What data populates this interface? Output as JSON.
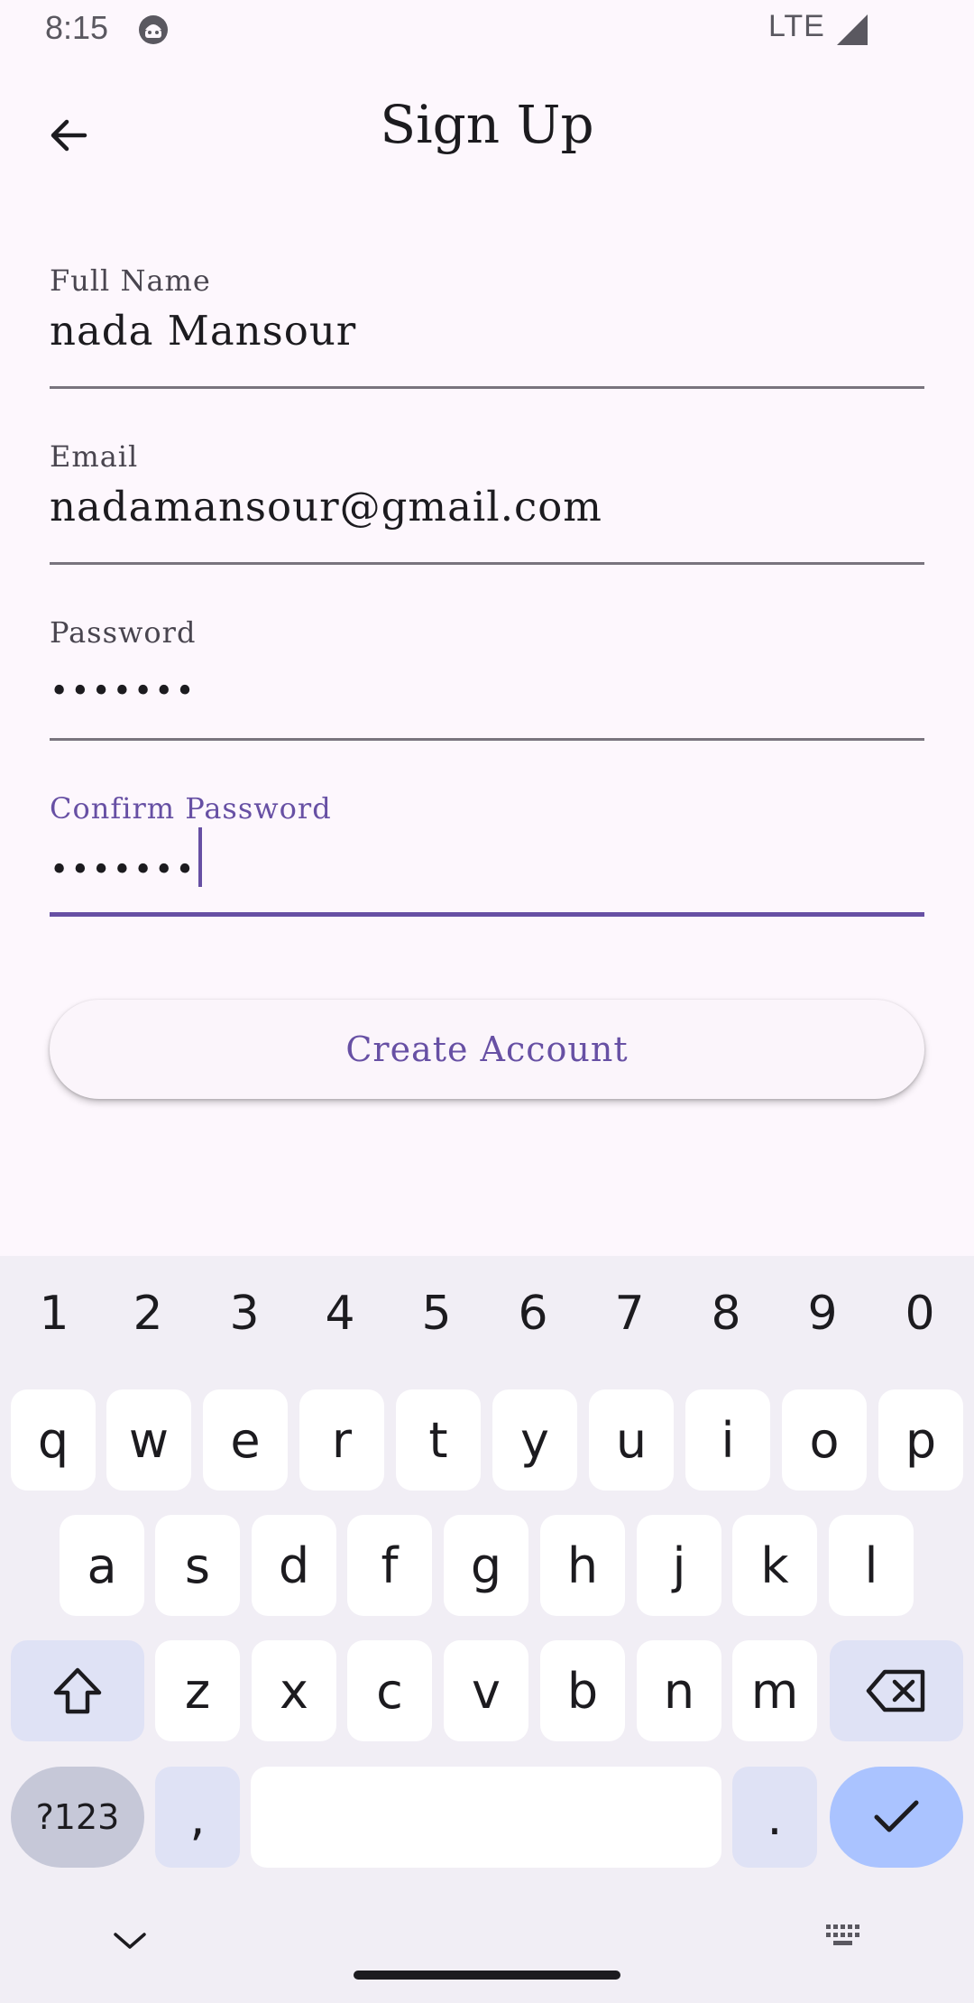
{
  "status_bar": {
    "time": "8:15",
    "network": "LTE"
  },
  "header": {
    "title": "Sign Up"
  },
  "form": {
    "full_name": {
      "label": "Full Name",
      "value": "nada Mansour"
    },
    "email": {
      "label": "Email",
      "value": "nadamansour@gmail.com"
    },
    "password": {
      "label": "Password",
      "value": "•••••••"
    },
    "confirm_password": {
      "label": "Confirm Password",
      "value": "•••••••"
    },
    "submit_label": "Create Account"
  },
  "keyboard": {
    "numbers": [
      "1",
      "2",
      "3",
      "4",
      "5",
      "6",
      "7",
      "8",
      "9",
      "0"
    ],
    "row1": [
      "q",
      "w",
      "e",
      "r",
      "t",
      "y",
      "u",
      "i",
      "o",
      "p"
    ],
    "row2": [
      "a",
      "s",
      "d",
      "f",
      "g",
      "h",
      "j",
      "k",
      "l"
    ],
    "row3": [
      "z",
      "x",
      "c",
      "v",
      "b",
      "n",
      "m"
    ],
    "symbols_label": "?123",
    "comma": ",",
    "period": "."
  },
  "colors": {
    "accent": "#6750a4",
    "background": "#fdf7fd",
    "keyboard_bg": "#f1eef5",
    "enter_key": "#aac3ff"
  }
}
